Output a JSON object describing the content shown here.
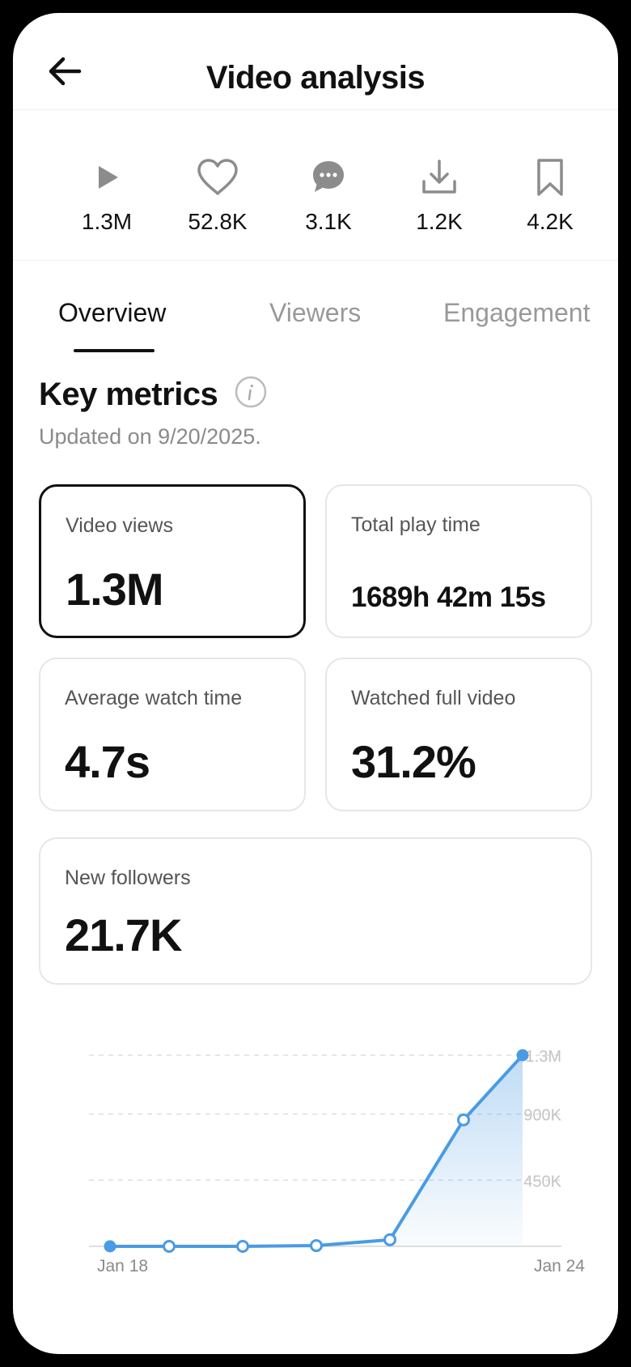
{
  "header": {
    "title": "Video analysis"
  },
  "stats": [
    {
      "icon": "play-icon",
      "value": "1.3M"
    },
    {
      "icon": "heart-icon",
      "value": "52.8K"
    },
    {
      "icon": "comment-icon",
      "value": "3.1K"
    },
    {
      "icon": "download-icon",
      "value": "1.2K"
    },
    {
      "icon": "bookmark-icon",
      "value": "4.2K"
    }
  ],
  "tabs": [
    {
      "label": "Overview",
      "active": true
    },
    {
      "label": "Viewers",
      "active": false
    },
    {
      "label": "Engagement",
      "active": false
    }
  ],
  "metrics": {
    "title": "Key metrics",
    "updated": "Updated on 9/20/2025.",
    "cards": [
      {
        "label": "Video views",
        "value": "1.3M"
      },
      {
        "label": "Total play time",
        "value": "1689h 42m 15s"
      },
      {
        "label": "Average watch time",
        "value": "4.7s"
      },
      {
        "label": "Watched full video",
        "value": "31.2%"
      },
      {
        "label": "New followers",
        "value": "21.7K"
      }
    ]
  },
  "colors": {
    "accent": "#4a9be3",
    "text": "#111111",
    "muted": "#999999"
  },
  "chart_data": {
    "type": "area",
    "x": [
      "Jan 18",
      "Jan 19",
      "Jan 20",
      "Jan 21",
      "Jan 22",
      "Jan 23",
      "Jan 24"
    ],
    "x_tick_labels": [
      "Jan 18",
      "Jan 24"
    ],
    "values": [
      0,
      0,
      0,
      5000,
      45000,
      860000,
      1300000
    ],
    "y_tick_labels": [
      "1.3M",
      "900K",
      "450K"
    ],
    "y_ticks": [
      1300000,
      900000,
      450000
    ],
    "ylim": [
      0,
      1300000
    ],
    "grid": true
  }
}
